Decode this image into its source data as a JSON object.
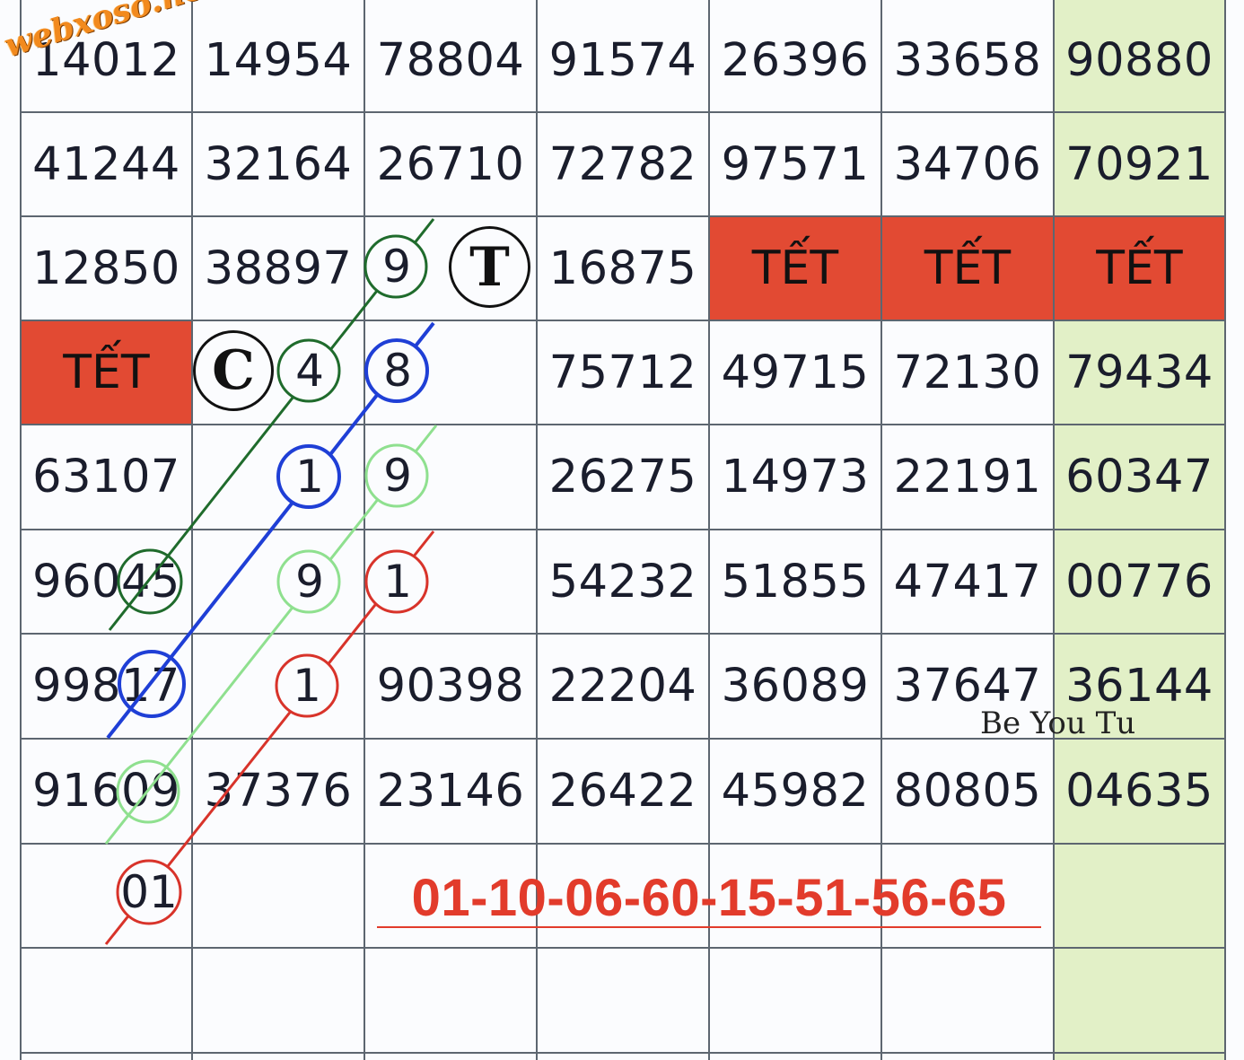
{
  "grid": {
    "rows": [
      [
        "14012",
        "14954",
        "78804",
        "91574",
        "26396",
        "33658",
        "90880"
      ],
      [
        "41244",
        "32164",
        "26710",
        "72782",
        "97571",
        "34706",
        "70921"
      ],
      [
        "12850",
        "38897",
        "",
        "",
        "16875",
        "TẾT",
        "TẾT",
        "TẾT"
      ],
      [
        "TẾT",
        "",
        "",
        "75712",
        "49715",
        "72130",
        "79434"
      ],
      [
        "63107",
        "",
        "",
        "26275",
        "14973",
        "22191",
        "60347"
      ],
      [
        "96045",
        "",
        "",
        "54232",
        "51855",
        "47417",
        "00776"
      ],
      [
        "99817",
        "",
        "90398",
        "22204",
        "36089",
        "37647",
        "36144"
      ],
      [
        "91609",
        "37376",
        "23146",
        "26422",
        "45982",
        "80805",
        "04635"
      ],
      [
        "",
        "",
        "",
        "",
        "",
        "",
        ""
      ],
      [
        "",
        "",
        "",
        "",
        "",
        "",
        ""
      ]
    ],
    "tet_label": "TẾT"
  },
  "cells": {
    "r0": [
      "14012",
      "14954",
      "78804",
      "91574",
      "26396",
      "33658",
      "90880"
    ],
    "r1": [
      "41244",
      "32164",
      "26710",
      "72782",
      "97571",
      "34706",
      "70921"
    ],
    "r2": [
      "12850",
      "38897",
      "16875"
    ],
    "r3": [
      "75712",
      "49715",
      "72130",
      "79434"
    ],
    "r4": [
      "63107",
      "26275",
      "14973",
      "22191",
      "60347"
    ],
    "r5": [
      "96045",
      "54232",
      "51855",
      "47417",
      "00776"
    ],
    "r6": [
      "99817",
      "90398",
      "22204",
      "36089",
      "37647",
      "36144"
    ],
    "r7": [
      "91609",
      "37376",
      "23146",
      "26422",
      "45982",
      "80805",
      "04635"
    ]
  },
  "tet": "TẾT",
  "markers": {
    "T": "T",
    "C": "C"
  },
  "digits": {
    "d_r2_c2": "9",
    "d_r3_c1": "4",
    "d_r3_c2": "8",
    "d_r4_c1": "1",
    "d_r4_c2": "9",
    "d_r5_c1": "9",
    "d_r5_c2": "1",
    "d_r6_c1": "1",
    "d_r8_c0": "01"
  },
  "result": "01-10-06-60-15-51-56-65",
  "watermark": "webxoso.net",
  "signature": "Be You Tu",
  "colors": {
    "tet_bg": "#e24a33",
    "highlight_col": "#e2f0c7",
    "dark_green": "#1f6b2c",
    "blue": "#1f3fd6",
    "light_green": "#8fe08f",
    "red": "#d8332a",
    "result_red": "#e23b2b"
  }
}
